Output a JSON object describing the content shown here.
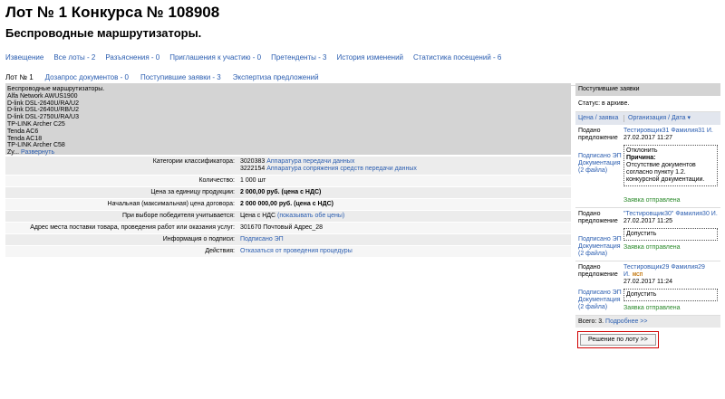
{
  "header": {
    "title": "Лот № 1 Конкурса № 108908",
    "subtitle": "Беспроводные маршрутизаторы."
  },
  "tabs_top": [
    {
      "label": "Извещение"
    },
    {
      "label": "Все лоты - 2"
    },
    {
      "label": "Разъяснения - 0"
    },
    {
      "label": "Приглашения к участию - 0"
    },
    {
      "label": "Претенденты - 3"
    },
    {
      "label": "История изменений"
    },
    {
      "label": "Статистика посещений - 6"
    }
  ],
  "tabs_lot": [
    {
      "label": "Лот № 1",
      "active": true
    },
    {
      "label": "Дозапрос документов - 0"
    },
    {
      "label": "Поступившие заявки - 3"
    },
    {
      "label": "Экспертиза предложений"
    }
  ],
  "description": {
    "lines": [
      "Беспроводные маршрутизаторы.",
      "Alfa Network AWUS1900",
      "D-link DSL-2640U/RA/U2",
      "D-link DSL-2640U/RB/U2",
      "D-link DSL-2750U/RA/U3",
      "TP-LINK Archer C25",
      "Tenda AC6",
      "Tenda AC18",
      "TP-LINK Archer C58"
    ],
    "truncated": "Zy...",
    "expand_link": "Развернуть"
  },
  "params": {
    "classifier_label": "Категории классификатора:",
    "classifier_1_code": "3020383",
    "classifier_1_link": "Аппаратура передачи данных",
    "classifier_2_code": "3222154",
    "classifier_2_link": "Аппаратура сопряжения средств передачи данных",
    "quantity_label": "Количество:",
    "quantity_value": "1 000 шт",
    "unit_price_label": "Цена за единицу продукции:",
    "unit_price_value": "2 000,00 руб. (цена с НДС)",
    "max_price_label": "Начальная (максимальная) цена договора:",
    "max_price_value": "2 000 000,00 руб. (цена с НДС)",
    "winner_label": "При выборе победителя учитывается:",
    "winner_value": "Цена с НДС",
    "winner_link": "(показывать обе цены)",
    "address_label": "Адрес места поставки товара, проведения работ или оказания услуг:",
    "address_value": "301670 Почтовый Адрес_28",
    "signature_label": "Информация о подписи:",
    "signature_link": "Подписано ЭП",
    "actions_label": "Действия:",
    "actions_link": "Отказаться от проведения процедуры"
  },
  "sidebar": {
    "header": "Поступившие заявки",
    "status": "Статус: в архиве.",
    "col_price": "Цена / заявка",
    "col_org": "Организация / Дата ▾",
    "bids": [
      {
        "submitted": "Подано предложение",
        "org": "Тестировщик31 Фамилия31 И.",
        "date": "27.02.2017 11:27",
        "signed": "Подписано ЭП",
        "docs": "Документация (2 файла)",
        "decision": "Отклонить",
        "reason_label": "Причина:",
        "reason": "Отсутствие документов согласно пункту 1.2. конкурсной документации.",
        "sent": "Заявка отправлена"
      },
      {
        "submitted": "Подано предложение",
        "org": "\"Тестировщик30\" Фамилия30 И.",
        "date": "27.02.2017 11:25",
        "signed": "Подписано ЭП",
        "docs": "Документация (2 файла)",
        "decision": "Допустить",
        "sent": "Заявка отправлена"
      },
      {
        "submitted": "Подано предложение",
        "org": "Тестировщик29 Фамилия29 И.",
        "badge": "МСП",
        "date": "27.02.2017 11:24",
        "signed": "Подписано ЭП",
        "docs": "Документация (2 файла)",
        "decision": "Допустить",
        "sent": "Заявка отправлена"
      }
    ],
    "total": "Всего: 3.",
    "more_link": "Подробнее >>",
    "decision_button": "Решение по лоту >>"
  }
}
